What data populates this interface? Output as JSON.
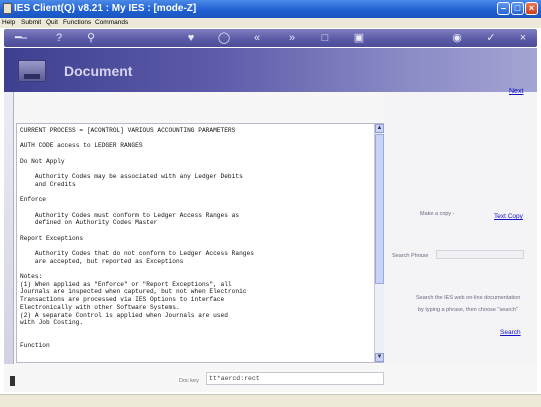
{
  "window": {
    "title": "IES Client(Q) v8.21 : My IES :     [mode-Z]"
  },
  "menu": [
    "Help",
    "Submit",
    "Quit",
    "Functions",
    "Commands"
  ],
  "toolbar_icons": [
    "key-icon",
    "help-icon",
    "search-icon",
    "heart-icon",
    "clock-icon",
    "rewind-icon",
    "fast-forward-icon",
    "printer-icon",
    "save-icon",
    "globe-icon",
    "check-icon",
    "close-icon"
  ],
  "banner": {
    "title": "Document"
  },
  "nav": {
    "next": "Next"
  },
  "document": {
    "lines": [
      "CURRENT PROCESS = [ACONTROL] VARIOUS ACCOUNTING PARAMETERS",
      "",
      "AUTH CODE access to LEDGER RANGES",
      "",
      "Do Not Apply",
      "",
      "    Authority Codes may be associated with any Ledger Debits",
      "    and Credits",
      "",
      "Enforce",
      "",
      "    Authority Codes must conform to Ledger Access Ranges as",
      "    defined on Authority Codes Master",
      "",
      "Report Exceptions",
      "",
      "    Authority Codes that do not conform to Ledger Access Ranges",
      "    are accepted, but reported as Exceptions",
      "",
      "Notes:",
      "(1) When applied as \"Enforce\" or \"Report Exceptions\", all",
      "Journals are inspected when captured, but not when Electronic",
      "Transactions are processed via IES Options to interface",
      "Electronically with other Software Systems.",
      "(2) A separate Control is applied when Journals are used",
      "with Job Costing.",
      "",
      "",
      "Function"
    ]
  },
  "side": {
    "make_copy_label": "Make a copy -",
    "text_copy": "Text Copy",
    "search_phrase_label": "Search Phrase",
    "search_help_1": "Search the IES web on-line documentation",
    "search_help_2": "by typing a phrase, then choose \"search\"",
    "search_link": "Search"
  },
  "footer": {
    "doc_key_label": "Doc key",
    "doc_key_value": "tt*aercd:rect"
  },
  "colors": {
    "banner": "#5c5caa",
    "link": "#1212c8",
    "titlebar": "#1f5fd0"
  }
}
